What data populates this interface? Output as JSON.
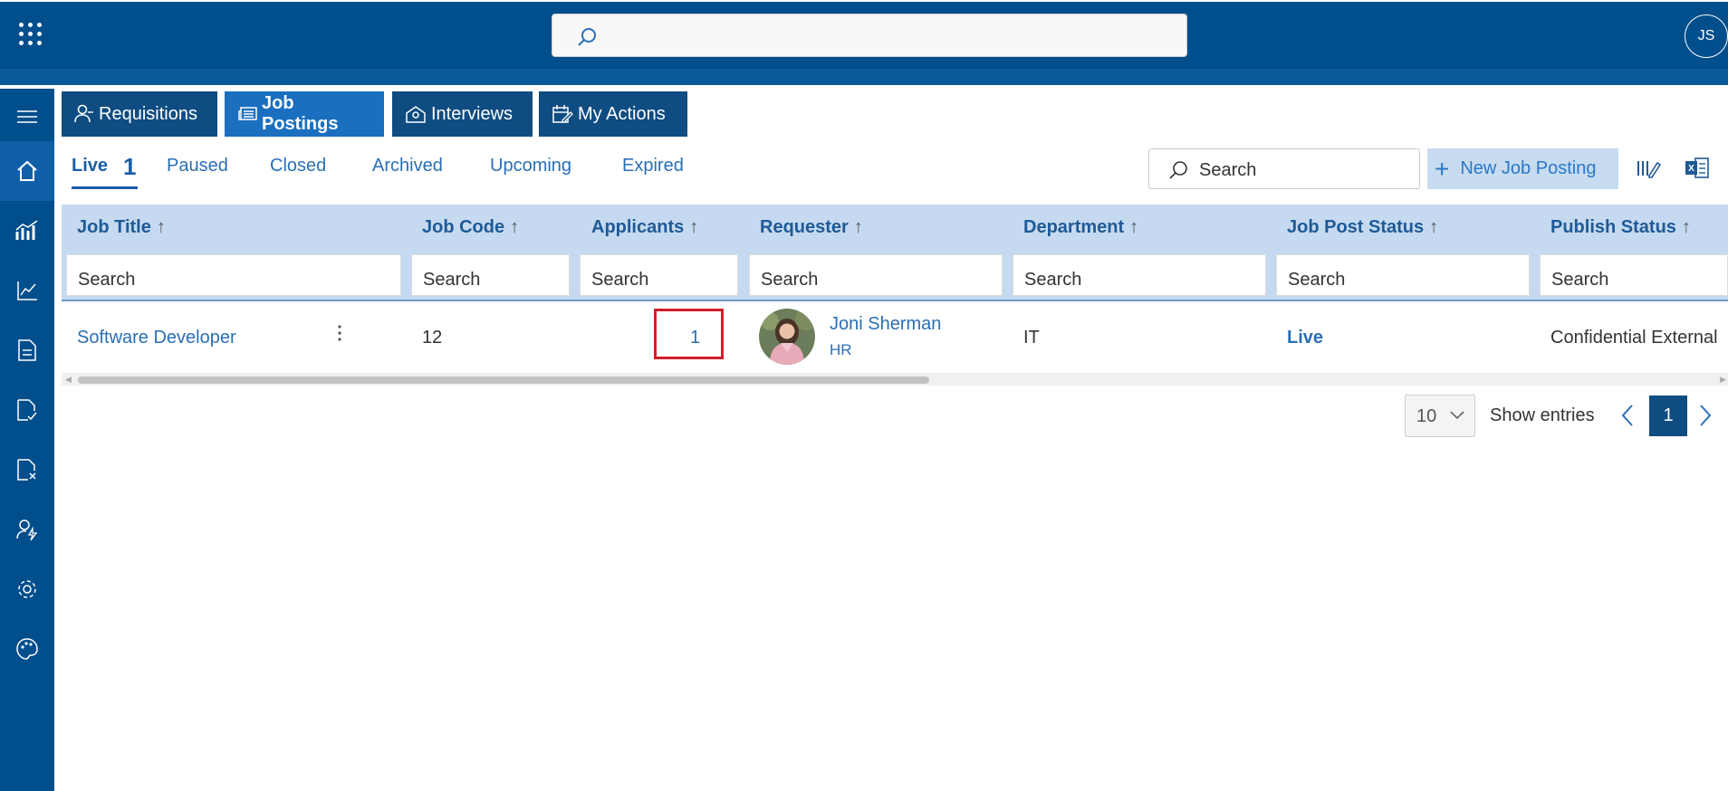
{
  "topbar": {
    "search_placeholder": "",
    "user_initials": "JS"
  },
  "module_tabs": [
    {
      "label": "Requisitions",
      "icon": "person-icon"
    },
    {
      "label": "Job Postings",
      "icon": "newspaper-icon",
      "active": true
    },
    {
      "label": "Interviews",
      "icon": "interview-icon"
    },
    {
      "label": "My Actions",
      "icon": "calendar-edit-icon"
    }
  ],
  "status_tabs": {
    "live": "Live",
    "live_count": "1",
    "paused": "Paused",
    "closed": "Closed",
    "archived": "Archived",
    "upcoming": "Upcoming",
    "expired": "Expired"
  },
  "toolbar": {
    "search_label": "Search",
    "new_button": "New Job Posting"
  },
  "table": {
    "headers": [
      "Job Title",
      "Job Code",
      "Applicants",
      "Requester",
      "Department",
      "Job Post Status",
      "Publish Status"
    ],
    "sort_arrow": "↑",
    "filter_placeholder": "Search",
    "rows": [
      {
        "job_title": "Software Developer",
        "job_code": "12",
        "applicants": "1",
        "requester_name": "Joni Sherman",
        "requester_dept": "HR",
        "department": "IT",
        "job_post_status": "Live",
        "publish_status": "Confidential External"
      }
    ]
  },
  "pagination": {
    "page_size": "10",
    "show_entries": "Show entries",
    "current_page": "1"
  },
  "colors": {
    "brand": "#004e8c",
    "header_bg": "#c5daf0",
    "link": "#2a6fb5",
    "highlight": "#d0202a"
  }
}
